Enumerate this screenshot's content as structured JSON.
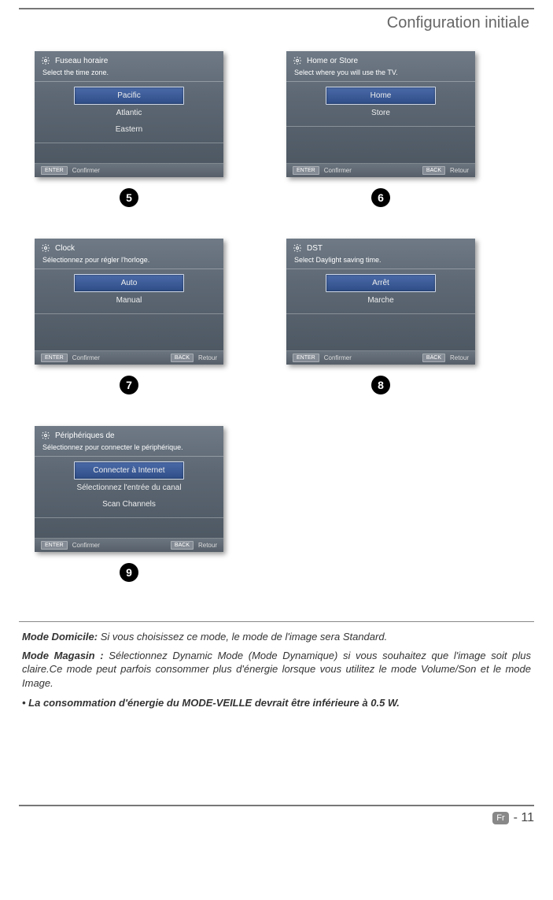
{
  "header": {
    "title": "Configuration initiale"
  },
  "panels": [
    {
      "step": "5",
      "title": "Fuseau horaire",
      "sub": "Select the time zone.",
      "options": [
        "Pacific",
        "Atlantic",
        "Eastern"
      ],
      "selected": 0,
      "footer": [
        {
          "key": "ENTER",
          "label": "Confirmer"
        }
      ]
    },
    {
      "step": "6",
      "title": "Home or Store",
      "sub": "Select where you will use the TV.",
      "options": [
        "Home",
        "Store"
      ],
      "selected": 0,
      "footer": [
        {
          "key": "ENTER",
          "label": "Confirmer"
        },
        {
          "key": "BACK",
          "label": "Retour"
        }
      ]
    },
    {
      "step": "7",
      "title": "Clock",
      "sub": "Sélectionnez pour régler l'horloge.",
      "options": [
        "Auto",
        "Manual"
      ],
      "selected": 0,
      "footer": [
        {
          "key": "ENTER",
          "label": "Confirmer"
        },
        {
          "key": "BACK",
          "label": "Retour"
        }
      ]
    },
    {
      "step": "8",
      "title": "DST",
      "sub": "Select Daylight saving time.",
      "options": [
        "Arrêt",
        "Marche"
      ],
      "selected": 0,
      "footer": [
        {
          "key": "ENTER",
          "label": "Confirmer"
        },
        {
          "key": "BACK",
          "label": "Retour"
        }
      ]
    },
    {
      "step": "9",
      "title": "Périphériques de",
      "sub": "Sélectionnez pour connecter le périphérique.",
      "options": [
        "Connecter à Internet",
        "Sélectionnez l'entrée du canal",
        "Scan Channels"
      ],
      "selected": 0,
      "footer": [
        {
          "key": "ENTER",
          "label": "Confirmer"
        },
        {
          "key": "BACK",
          "label": "Retour"
        }
      ]
    }
  ],
  "body": {
    "mode_domicile_label": "Mode Domicile:",
    "mode_domicile_text": " Si vous choisissez ce mode, le mode de l'image sera Standard.",
    "mode_magasin_label": "Mode Magasin :",
    "mode_magasin_text": "  Sélectionnez  Dynamic Mode (Mode Dynamique) si vous souhaitez que l'image soit plus claire.Ce mode peut parfois consommer plus d'énergie lorsque vous utilitez le mode Volume/Son et le mode Image.",
    "bullet": "• La consommation d'énergie du MODE-VEILLE devrait être inférieure à 0.5 W."
  },
  "footer": {
    "lang": "Fr",
    "page": "- 11"
  },
  "icons": {
    "gear": "gear-icon"
  }
}
